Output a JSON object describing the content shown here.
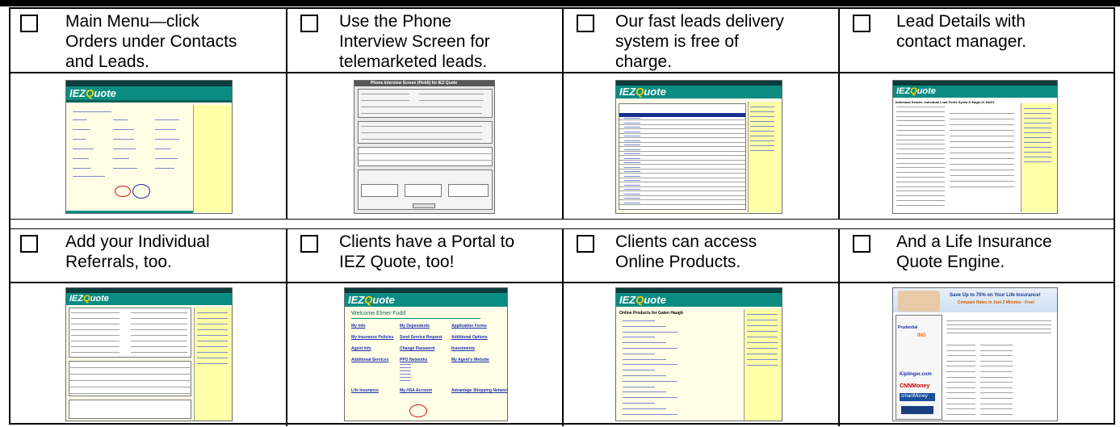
{
  "cells": [
    {
      "caption": [
        "Main Menu—click",
        "Orders under Contacts",
        "and Leads."
      ],
      "thumb": "main-menu"
    },
    {
      "caption": [
        "Use the Phone",
        "Interview Screen for",
        "telemarketed leads."
      ],
      "thumb": "phone-interview"
    },
    {
      "caption": [
        "Our fast leads delivery",
        "system is free of",
        "charge."
      ],
      "thumb": "leads-delivery"
    },
    {
      "caption": [
        "Lead Details with",
        "contact manager."
      ],
      "thumb": "lead-details"
    },
    {
      "caption": [
        "Add your Individual",
        "Referrals, too."
      ],
      "thumb": "referrals"
    },
    {
      "caption": [
        "Clients have a Portal to",
        "IEZ Quote, too!"
      ],
      "thumb": "client-portal"
    },
    {
      "caption": [
        "Clients can access",
        "Online Products."
      ],
      "thumb": "online-products"
    },
    {
      "caption": [
        "And a Life Insurance",
        "Quote Engine."
      ],
      "thumb": "quote-engine"
    }
  ],
  "thumbs": {
    "logo_text": "IEZ",
    "logo_q": "Q",
    "logo_rest": "uote",
    "phone_title": "Phone Interview Screen (Pick6) for IEZ Quote",
    "portal_welcome": "Welcome Elmer Fudd",
    "portal_links": [
      [
        "My Info",
        "My Dependents",
        "Application Forms"
      ],
      [
        "My Insurance Policies",
        "Send Service Request",
        "Additional Options"
      ],
      [
        "Agent Info",
        "Change Password",
        "Investments"
      ],
      [
        "Additional Services",
        "PPO Networks",
        "My Agent's Website"
      ],
      [
        "Life Insurance",
        "My HSA Account",
        "Advantage Shopping Network"
      ]
    ],
    "online_title": "Online Products for Galen Haugh",
    "lead_title": "Individual Details: Individual Lead Fortis Sylvia K Eagle-IC 94201",
    "quote_banner": "Save Up to 70% on Your Life Insurance!",
    "quote_sub": "Compare Rates in Just 2 Minutes - Free!",
    "quote_logos": [
      "Prudential",
      "ING",
      "Kiplinger.com",
      "CNNMoney",
      "smartMoney"
    ]
  },
  "colors": {
    "header_dark": "#0c3b3b",
    "header_teal": "#0a8c82",
    "page_bg": "#fffde6",
    "sidebar_yellow": "#ffffa8",
    "link_blue": "#1a2fb0"
  }
}
